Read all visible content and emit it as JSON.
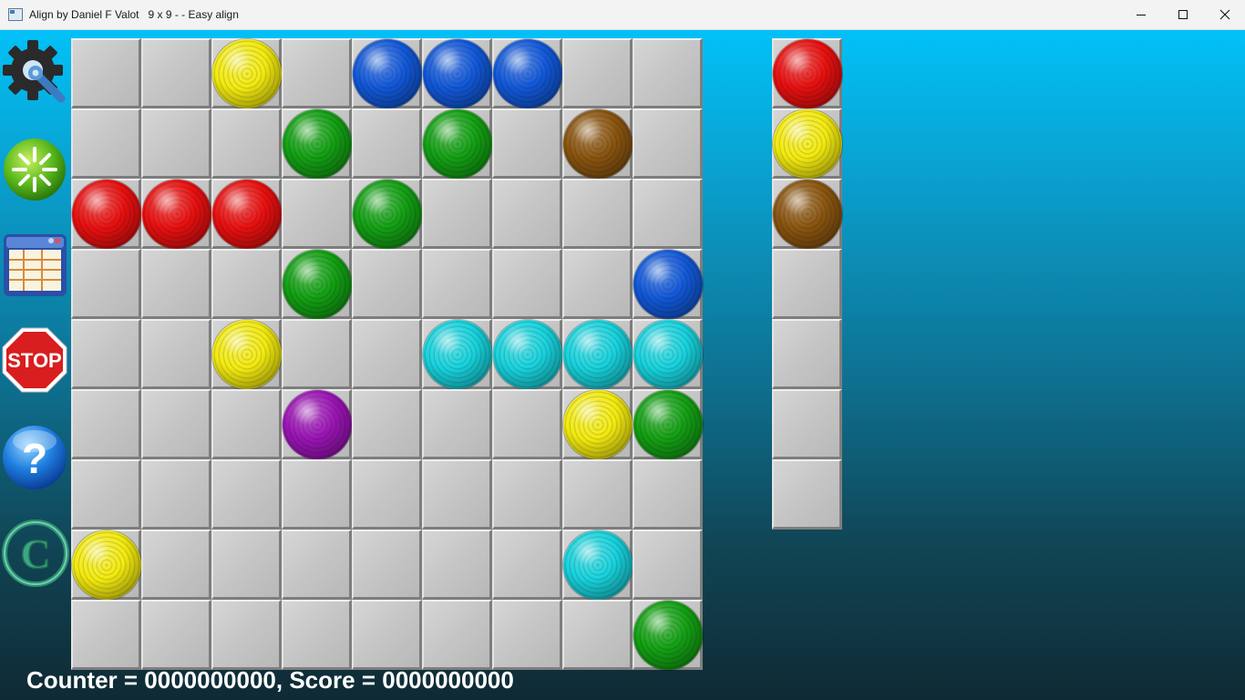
{
  "window": {
    "title": "Align by Daniel F Valot   9 x 9 - - Easy align"
  },
  "toolbar": [
    {
      "name": "settings-button",
      "icon": "gear-wrench-icon"
    },
    {
      "name": "new-game-button",
      "icon": "sparkle-icon"
    },
    {
      "name": "scores-button",
      "icon": "table-window-icon"
    },
    {
      "name": "stop-button",
      "icon": "stop-sign-icon",
      "label": "STOP"
    },
    {
      "name": "help-button",
      "icon": "question-icon",
      "label": "?"
    },
    {
      "name": "about-button",
      "icon": "copyright-icon",
      "label": "C"
    }
  ],
  "colors": {
    "R": "#e81010",
    "Y": "#f2ea10",
    "B": "#1258d8",
    "G": "#14a014",
    "N": "#8a5510",
    "C": "#18d2dc",
    "M": "#9a14b4"
  },
  "board": {
    "size": "9 x 9",
    "rows": [
      "..Y.BBB..",
      "...G.G.N.",
      "RRR.G....",
      "...G....B",
      "..Y..CCCC",
      "...M...YG",
      ".........",
      "Y......C.",
      "........G"
    ]
  },
  "next_balls": [
    "R",
    "Y",
    "N",
    ".",
    ".",
    ".",
    "."
  ],
  "status": {
    "text": "Counter = 0000000000, Score = 0000000000"
  }
}
